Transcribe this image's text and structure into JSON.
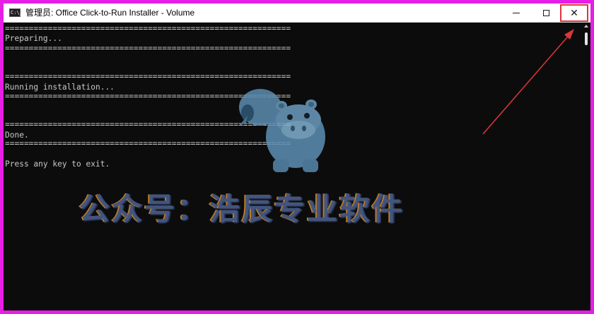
{
  "window": {
    "title": "管理员:  Office Click-to-Run Installer - Volume",
    "app_icon_text": "C:\\_"
  },
  "console": {
    "lines": [
      "============================================================",
      "Preparing...",
      "============================================================",
      "",
      "",
      "============================================================",
      "Running installation...",
      "============================================================",
      "",
      "",
      "============================================================",
      "Done.",
      "============================================================",
      "",
      "Press any key to exit."
    ]
  },
  "watermark": {
    "text": "公众号：浩辰专业软件"
  },
  "colors": {
    "background_frame": "#e61ee6",
    "console_bg": "#0c0c0c",
    "console_text": "#c8c8c8",
    "highlight_red": "#e0363a"
  },
  "icons": [
    "console-app-icon",
    "minimize-icon",
    "maximize-icon",
    "close-icon",
    "hippo-mascot-image",
    "annotation-arrow"
  ]
}
